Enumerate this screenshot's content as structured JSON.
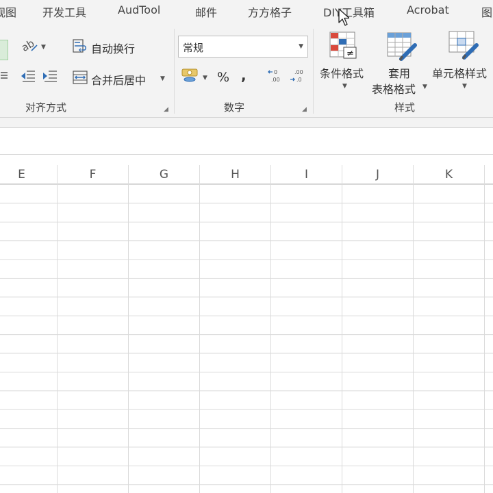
{
  "menu": {
    "tabs": [
      "视图",
      "开发工具",
      "AudTool",
      "邮件",
      "方方格子",
      "DIY工具箱",
      "Acrobat",
      "图"
    ]
  },
  "ribbon": {
    "alignment": {
      "wrap_text_label": "自动换行",
      "merge_center_label": "合并后居中",
      "group_label": "对齐方式"
    },
    "number": {
      "format_value": "常规",
      "percent_symbol": "%",
      "comma_symbol": ",",
      "group_label": "数字"
    },
    "styles": {
      "conditional_formatting_label": "条件格式",
      "format_as_table_label_1": "套用",
      "format_as_table_label_2": "表格格式",
      "cell_styles_label": "单元格样式",
      "group_label": "样式"
    }
  },
  "sheet": {
    "columns": [
      "E",
      "F",
      "G",
      "H",
      "I",
      "J",
      "K"
    ]
  },
  "colors": {
    "ribbon_bg": "#f3f3f3",
    "gridline": "#dadada",
    "accent_green": "#9fcf9f"
  }
}
